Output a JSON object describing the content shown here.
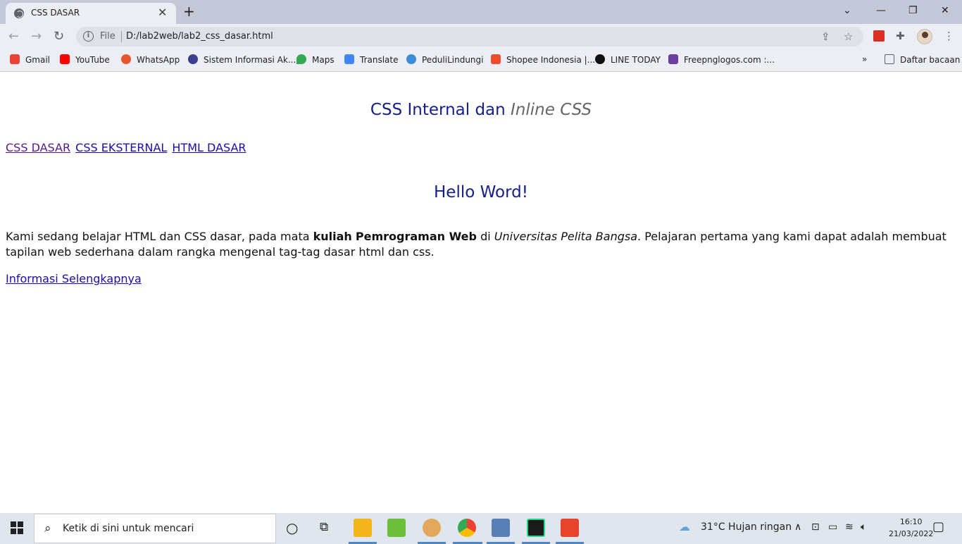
{
  "browser": {
    "tab_title": "CSS DASAR",
    "scheme": "File",
    "url": "D:/lab2web/lab2_css_dasar.html"
  },
  "bookmarks": [
    {
      "label": "Gmail",
      "color": "#ea4335"
    },
    {
      "label": "YouTube",
      "color": "#ff0000"
    },
    {
      "label": "WhatsApp",
      "color": "#e8542f"
    },
    {
      "label": "Sistem Informasi Ak...",
      "color": "#3b3f8f"
    },
    {
      "label": "Maps",
      "color": "#34a853"
    },
    {
      "label": "Translate",
      "color": "#4285f4"
    },
    {
      "label": "PeduliLindungi",
      "color": "#3f8ad8"
    },
    {
      "label": "Shopee Indonesia |...",
      "color": "#ee4d2d"
    },
    {
      "label": "LINE TODAY",
      "color": "#111111"
    },
    {
      "label": "Freepnglogos.com :...",
      "color": "#6b3fa0"
    }
  ],
  "reading_list": "Daftar bacaan",
  "page": {
    "title_plain": "CSS Internal dan",
    "title_italic": "Inline CSS",
    "links": [
      "CSS DASAR",
      "CSS EKSTERNAL",
      "HTML DASAR"
    ],
    "heading": "Hello Word!",
    "para_1": "Kami sedang belajar HTML dan CSS dasar, pada mata",
    "para_bold_1": "kuliah",
    "para_bold_2": "Pemrograman Web",
    "para_2": "di",
    "para_italic": "Universitas Pelita Bangsa",
    "para_3": ". Pelajaran pertama yang kami dapat adalah membuat tapilan web sederhana dalam rangka mengenal tag-tag dasar html dan css.",
    "more_link": "Informasi Selengkapnya"
  },
  "taskbar": {
    "search_placeholder": "Ketik di sini untuk mencari",
    "weather": "31°C  Hujan ringan",
    "time": "16:10",
    "date": "21/03/2022"
  }
}
